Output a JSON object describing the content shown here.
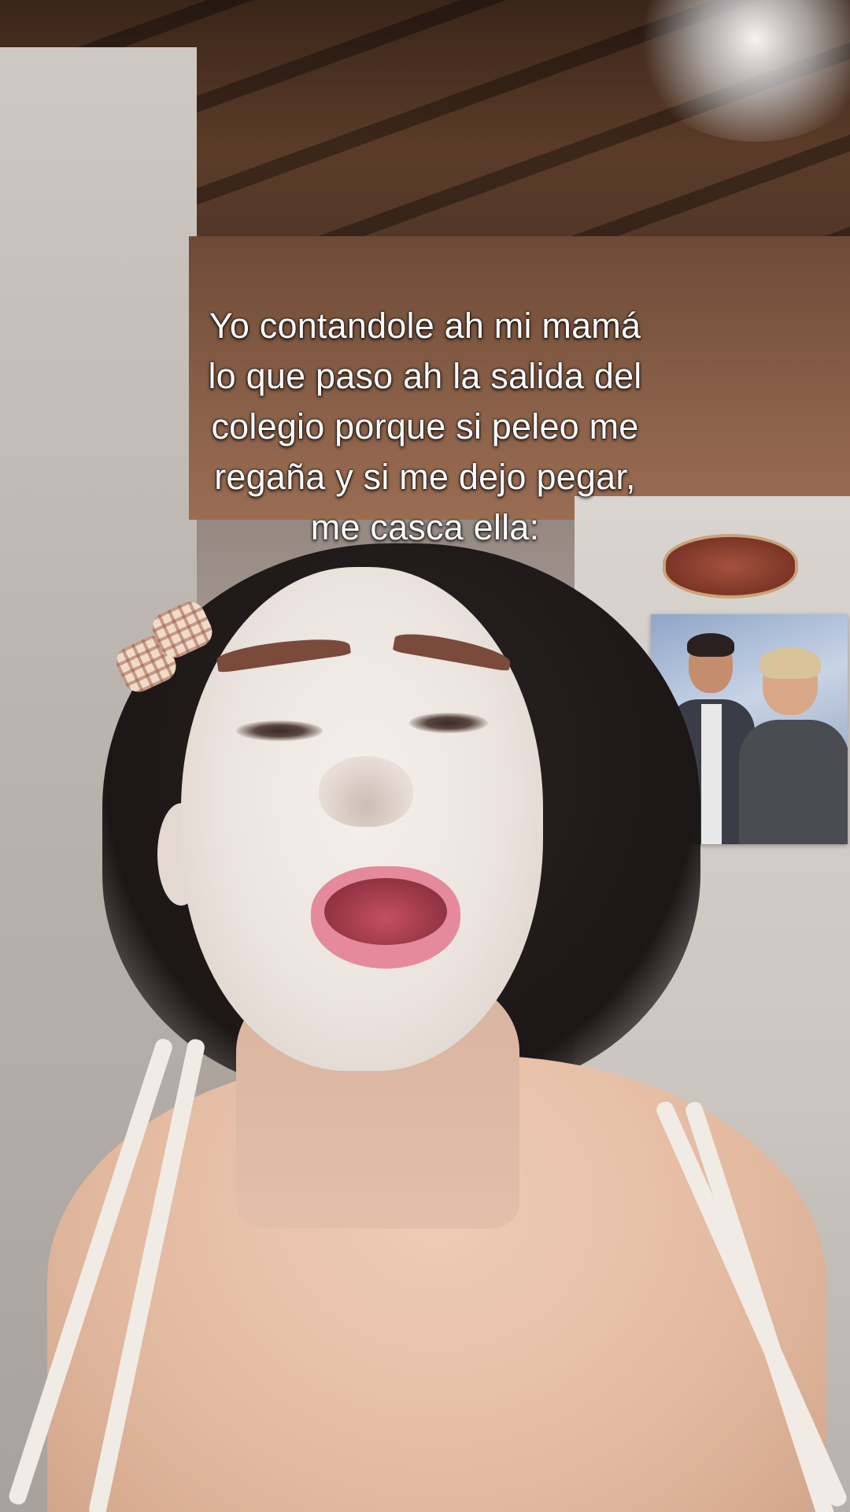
{
  "caption": {
    "lines": [
      "Yo contandole ah mi mamá",
      "lo que paso ah la salida del",
      "colegio porque si peleo me",
      "regaña y si me dejo pegar,",
      "me casca ella:"
    ]
  }
}
